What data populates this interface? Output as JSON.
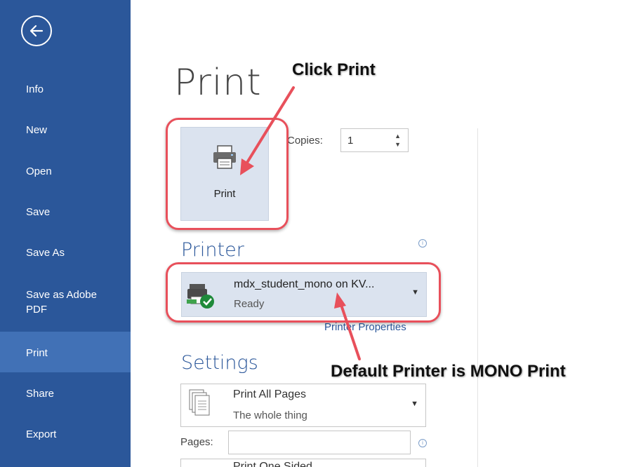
{
  "sidebar": {
    "items": [
      {
        "label": "Info"
      },
      {
        "label": "New"
      },
      {
        "label": "Open"
      },
      {
        "label": "Save"
      },
      {
        "label": "Save As"
      },
      {
        "label": "Save as Adobe",
        "label2": "PDF"
      },
      {
        "label": "Print"
      },
      {
        "label": "Share"
      },
      {
        "label": "Export"
      }
    ],
    "back_icon": "back-arrow-icon"
  },
  "main": {
    "title": "Print",
    "print_button_label": "Print",
    "copies_label": "Copies:",
    "copies_value": "1",
    "printer_heading": "Printer",
    "printer": {
      "name": "mdx_student_mono on KV...",
      "status": "Ready"
    },
    "printer_properties": "Printer Properties",
    "settings_heading": "Settings",
    "settings_pages": {
      "title": "Print All Pages",
      "sub": "The whole thing"
    },
    "pages_label": "Pages:",
    "sided": {
      "title": "Print One Sided"
    }
  },
  "annotations": {
    "click_print": "Click Print",
    "default_printer": "Default Printer is MONO Print",
    "color": "#e8505b"
  },
  "colors": {
    "accent": "#2b579a",
    "sidebar_active": "#4171b6",
    "selected_bg": "#dbe3ef"
  }
}
